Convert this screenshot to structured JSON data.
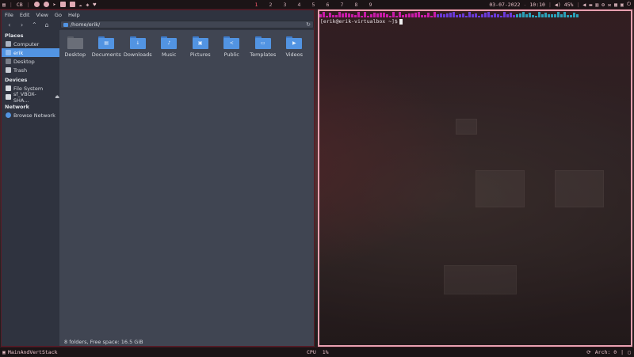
{
  "topbar": {
    "layout_label": "CB",
    "workspaces": [
      "1",
      "2",
      "3",
      "4",
      "5",
      "6",
      "7",
      "8",
      "9"
    ],
    "active_workspace": "1",
    "date": "03-07-2022",
    "time": "10:10",
    "volume": "45%",
    "icons": [
      "fire-icon",
      "mail-icon",
      "telegram-icon",
      "terminal-icon",
      "calendar-icon",
      "cloud-icon",
      "vim-icon",
      "heart-icon"
    ]
  },
  "filemanager": {
    "menu": [
      "File",
      "Edit",
      "View",
      "Go",
      "Help"
    ],
    "path": "/home/erik/",
    "sidebar": {
      "places_header": "Places",
      "places": [
        {
          "label": "Computer",
          "icon": "computer-icon"
        },
        {
          "label": "erik",
          "icon": "home-folder-icon",
          "selected": true
        },
        {
          "label": "Desktop",
          "icon": "desktop-icon"
        },
        {
          "label": "Trash",
          "icon": "trash-icon"
        }
      ],
      "devices_header": "Devices",
      "devices": [
        {
          "label": "File System",
          "icon": "drive-icon"
        },
        {
          "label": "sf_VBOX-SHA...",
          "icon": "drive-icon"
        }
      ],
      "network_header": "Network",
      "network": [
        {
          "label": "Browse Network",
          "icon": "network-icon"
        }
      ]
    },
    "folders": [
      {
        "label": "Desktop",
        "glyph": "",
        "color": "#6a6e78"
      },
      {
        "label": "Documents",
        "glyph": "▤",
        "color": "#5294e2"
      },
      {
        "label": "Downloads",
        "glyph": "↓",
        "color": "#5294e2"
      },
      {
        "label": "Music",
        "glyph": "♪",
        "color": "#5294e2"
      },
      {
        "label": "Pictures",
        "glyph": "▣",
        "color": "#5294e2"
      },
      {
        "label": "Public",
        "glyph": "<",
        "color": "#5294e2"
      },
      {
        "label": "Templates",
        "glyph": "▭",
        "color": "#5294e2"
      },
      {
        "label": "Videos",
        "glyph": "▶",
        "color": "#5294e2"
      }
    ],
    "status": "8 folders, Free space: 16.5 GiB"
  },
  "terminal": {
    "prompt": "[erik@erik-virtualbox ~]$"
  },
  "bottombar": {
    "layout_name": "MainAndVertStack",
    "cpu_label": "CPU",
    "cpu_value": "1%",
    "updates_label": "Arch: 0"
  },
  "colors": {
    "accent": "#5294e2",
    "active_workspace": "#ff5a6e",
    "terminal_border": "#e8a0b0"
  }
}
